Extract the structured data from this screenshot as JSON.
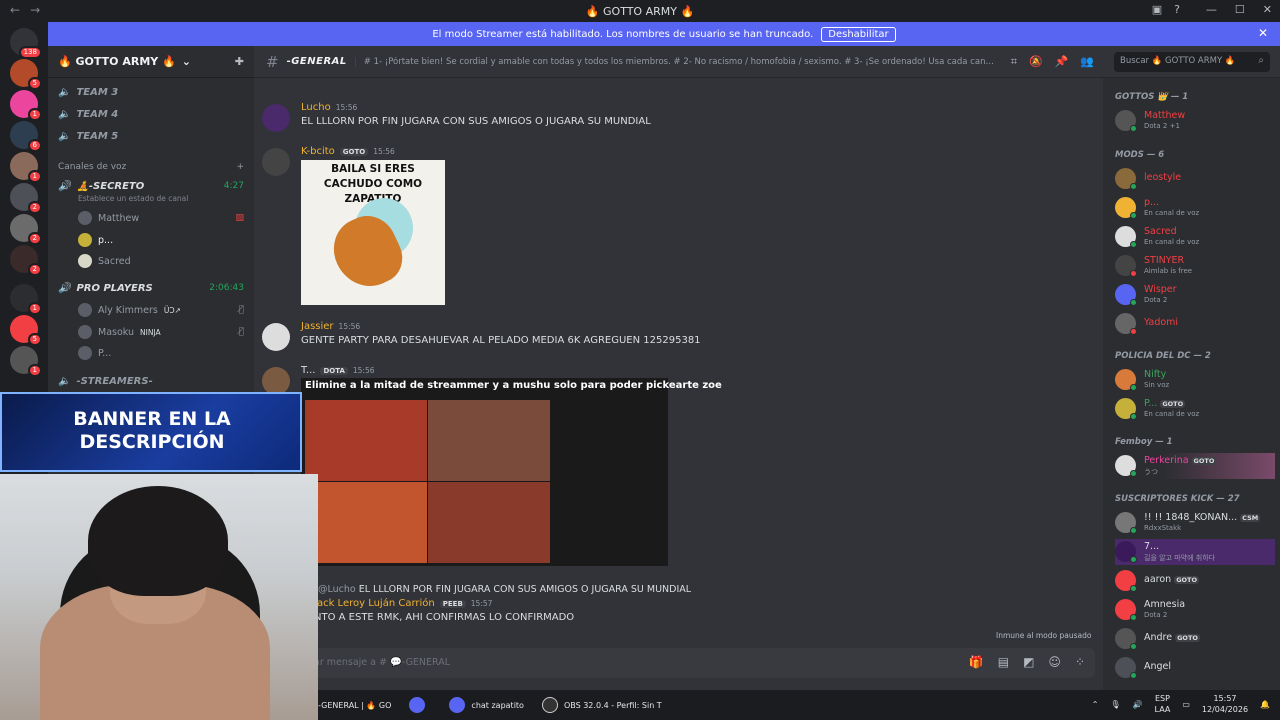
{
  "window": {
    "title": "🔥 GOTTO ARMY 🔥"
  },
  "streamer_mode": {
    "message": "El modo Streamer está habilitado. Los nombres de usuario se han truncado.",
    "button": "Deshabilitar"
  },
  "rail": {
    "home_badge": "138",
    "server_badges": [
      "5",
      "1",
      "6",
      "1",
      "2",
      "2",
      "2",
      "1",
      "5",
      "1"
    ]
  },
  "guild": {
    "name": "🔥 GOTTO ARMY 🔥"
  },
  "channels": {
    "team3": "TEAM 3",
    "team4": "TEAM 4",
    "team5": "TEAM 5",
    "voice_category": "Canales de voz",
    "secreto": {
      "name": "🧘-SECRETO",
      "time": "4:27",
      "hint": "Establece un estado de canal"
    },
    "secreto_users": [
      "Matthew",
      "p...",
      "Sacred"
    ],
    "pro": {
      "name": "PRO PLAYERS",
      "time": "2:06:43"
    },
    "pro_users": [
      {
        "name": "Aly Kimmers",
        "tag": "ÜƆ↗"
      },
      {
        "name": "Masoku",
        "tag": "NINJA"
      },
      {
        "name": "P..."
      }
    ],
    "streamers": "-STREAMERS-"
  },
  "header": {
    "channel": "-GENERAL",
    "topic": "# 1- ¡Pórtate bien! Se cordial y amable con todas y todos los miembros. # 2- No racismo / homofobia / sexismo. # 3- ¡Se ordenado! Usa cada canal para su r...",
    "search_placeholder": "Buscar 🔥 GOTTO ARMY 🔥"
  },
  "messages": [
    {
      "name": "Lucho",
      "time": "15:56",
      "text": "EL LLLORN POR FIN JUGARA CON SUS AMIGOS O JUGARA SU MUNDIAL",
      "color": "#f0b232"
    },
    {
      "name": "K-bcito",
      "tag": "GOTO",
      "time": "15:56",
      "text": "",
      "color": "#f0b232"
    },
    {
      "name": "Jassier",
      "time": "15:56",
      "text": "GENTE PARTY PARA DESAHUEVAR AL PELADO MEDIA 6K AGREGUEN 125295381",
      "color": "#f0b232"
    },
    {
      "name": "T...",
      "tag": "DOTA",
      "time": "15:56",
      "text": "",
      "color": "#dbdee1"
    },
    {
      "name": "Jack Leroy Luján Carrión",
      "tag": "PEEB",
      "time": "15:57",
      "text": "NTO A ESTE RMK, AHI CONFIRMAS LO CONFIRMADO",
      "color": "#f0b232"
    }
  ],
  "image_caption": "BAILA SI ERES CACHUDO COMO ZAPATITO",
  "meme_caption": "Elimine a la mitad de streammer y a mushu solo para poder pickearte zoe",
  "reply": {
    "mention": "@Lucho",
    "text": "EL LLLORN POR FIN JUGARA CON SUS AMIGOS O JUGARA SU MUNDIAL"
  },
  "pause_note": "Inmune al modo pausado",
  "composer": {
    "placeholder": "ar mensaje a # 💬-GENERAL"
  },
  "members": {
    "gottos": {
      "title": "GOTTOS 👑 — 1",
      "users": [
        {
          "name": "Matthew",
          "status": "Dota 2 +1"
        }
      ]
    },
    "mods": {
      "title": "MODS — 6",
      "users": [
        {
          "name": "leostyle",
          "status": ""
        },
        {
          "name": "p...",
          "status": "En canal de voz"
        },
        {
          "name": "Sacred",
          "status": "En canal de voz"
        },
        {
          "name": "STINYER",
          "status": "Aimlab is free"
        },
        {
          "name": "Wisper",
          "status": "Dota 2"
        },
        {
          "name": "Yadomi",
          "status": ""
        }
      ]
    },
    "policia": {
      "title": "POLICIA DEL DC — 2",
      "users": [
        {
          "name": "Nifty",
          "status": "Sin voz"
        },
        {
          "name": "P...",
          "tag": "GOTO",
          "status": "En canal de voz"
        }
      ]
    },
    "femboy": {
      "title": "Femboy — 1",
      "users": [
        {
          "name": "Perkerina",
          "tag": "GOTO",
          "status": "うつ"
        }
      ]
    },
    "subs": {
      "title": "SUSCRIPTORES KICK — 27",
      "users": [
        {
          "name": "!! !! 1848_KONAN...",
          "tag": "CSM",
          "status": "RdxxStakk"
        },
        {
          "name": "7...",
          "status": "길을 알고 마약에 취하다"
        },
        {
          "name": "aaron",
          "tag": "GOTO",
          "status": ""
        },
        {
          "name": "Amnesia",
          "status": "Dota 2"
        },
        {
          "name": "Andre",
          "tag": "GOTO",
          "status": ""
        },
        {
          "name": "Angel",
          "status": ""
        }
      ]
    }
  },
  "overlay": {
    "banner": "BANNER EN LA DESCRIPCIÓN"
  },
  "taskbar": {
    "items": [
      "-GENERAL | 🔥 GO",
      "",
      "chat zapatito",
      "OBS 32.0.4 - Perfil: Sin T"
    ],
    "lang": "ESP",
    "lang2": "LAA",
    "time": "15:57",
    "date": "12/04/2026"
  },
  "colors": {
    "blurple": "#5865f2",
    "mod_name": "#f23f43",
    "online": "#23a55a"
  }
}
